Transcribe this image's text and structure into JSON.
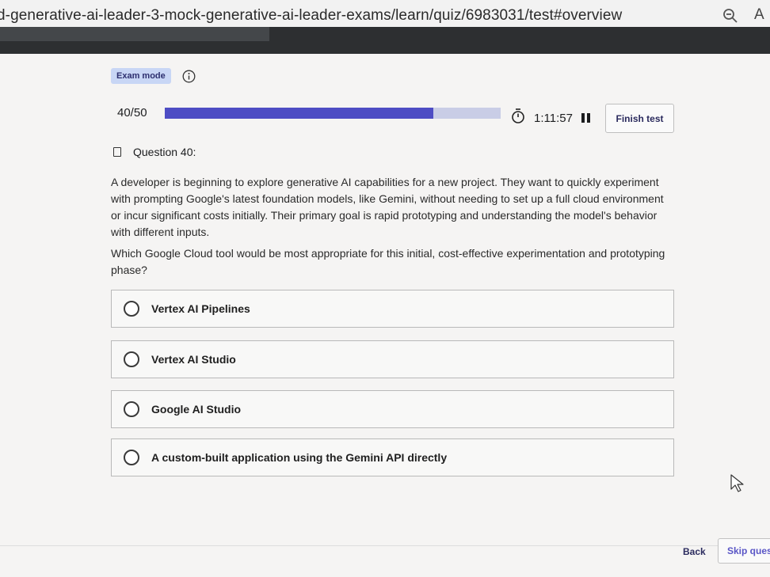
{
  "browser": {
    "url": "d-generative-ai-leader-3-mock-generative-ai-leader-exams/learn/quiz/6983031/test#overview",
    "reader_glyph": "A"
  },
  "exam": {
    "mode_label": "Exam mode",
    "progress_text": "40/50",
    "progress_fraction": 0.8,
    "timer": "1:11:57",
    "finish_label": "Finish test"
  },
  "question": {
    "heading": "Question 40:",
    "paragraphs": [
      "A developer is beginning to explore generative AI capabilities for a new project. They want to quickly experiment with prompting Google's latest foundation models, like Gemini, without needing to set up a full cloud environment or incur significant costs initially. Their primary goal is rapid prototyping and understanding the model's behavior with different inputs.",
      "Which Google Cloud tool would be most appropriate for this initial, cost-effective experimentation and prototyping phase?"
    ],
    "options": [
      {
        "label": "Vertex AI Pipelines"
      },
      {
        "label": "Vertex AI Studio"
      },
      {
        "label": "Google AI Studio"
      },
      {
        "label": "A custom-built application using the Gemini API directly"
      }
    ]
  },
  "footer": {
    "back_label": "Back",
    "skip_label": "Skip question"
  },
  "colors": {
    "accent": "#4e4dc4",
    "header": "#2d2f31",
    "badge_bg": "#c8d6f5"
  }
}
